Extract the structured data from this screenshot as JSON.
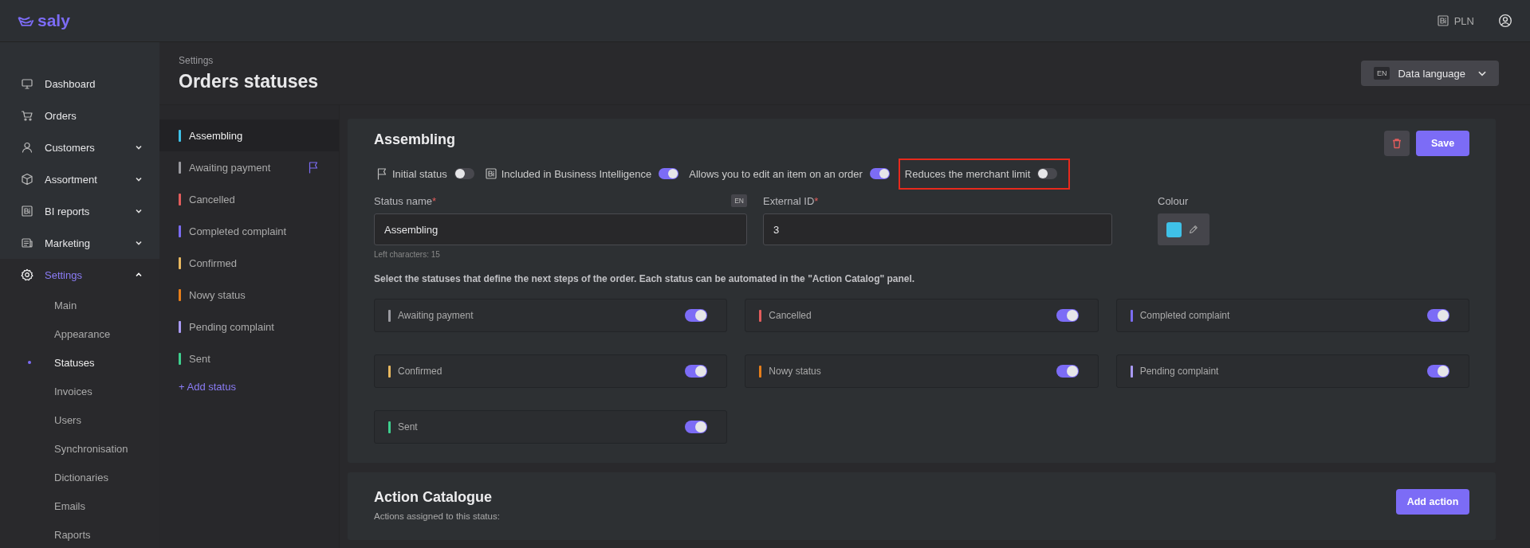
{
  "brand": {
    "name": "saly"
  },
  "topbar": {
    "currency": "PLN"
  },
  "sidebar": {
    "items": [
      {
        "label": "Dashboard",
        "selected": false
      },
      {
        "label": "Orders",
        "selected": false
      },
      {
        "label": "Customers",
        "selected": false,
        "expanded": false
      },
      {
        "label": "Assortment",
        "selected": false,
        "expanded": false
      },
      {
        "label": "BI reports",
        "selected": false,
        "expanded": false
      },
      {
        "label": "Marketing",
        "selected": false,
        "expanded": false
      },
      {
        "label": "Settings",
        "selected": true,
        "expanded": true,
        "children": [
          {
            "label": "Main",
            "selected": false
          },
          {
            "label": "Appearance",
            "selected": false
          },
          {
            "label": "Statuses",
            "selected": true
          },
          {
            "label": "Invoices",
            "selected": false
          },
          {
            "label": "Users",
            "selected": false
          },
          {
            "label": "Synchronisation",
            "selected": false
          },
          {
            "label": "Dictionaries",
            "selected": false
          },
          {
            "label": "Emails",
            "selected": false
          },
          {
            "label": "Raports",
            "selected": false
          }
        ]
      }
    ]
  },
  "header": {
    "breadcrumb": "Settings",
    "title": "Orders statuses",
    "language_code": "EN",
    "language_button": "Data language"
  },
  "statuses": [
    {
      "label": "Assembling",
      "color": "#3fc1e8",
      "selected": true,
      "initial": false
    },
    {
      "label": "Awaiting payment",
      "color": "#9a9aa0",
      "selected": false,
      "initial": true
    },
    {
      "label": "Cancelled",
      "color": "#e25c5c",
      "selected": false,
      "initial": false
    },
    {
      "label": "Completed complaint",
      "color": "#7b6cf2",
      "selected": false,
      "initial": false
    },
    {
      "label": "Confirmed",
      "color": "#e8b860",
      "selected": false,
      "initial": false
    },
    {
      "label": "Nowy status",
      "color": "#e67e1a",
      "selected": false,
      "initial": false
    },
    {
      "label": "Pending complaint",
      "color": "#a99af5",
      "selected": false,
      "initial": false
    },
    {
      "label": "Sent",
      "color": "#3ecf8e",
      "selected": false,
      "initial": false
    }
  ],
  "add_status": "+ Add status",
  "editor": {
    "title": "Assembling",
    "save": "Save",
    "options": [
      {
        "label": "Initial status",
        "on": false,
        "highlighted": false
      },
      {
        "label": "Included in Business Intelligence",
        "on": true,
        "highlighted": false
      },
      {
        "label": "Allows you to edit an item on an order",
        "on": true,
        "highlighted": false
      },
      {
        "label": "Reduces the merchant limit",
        "on": false,
        "highlighted": true
      }
    ],
    "status_name": {
      "label": "Status name",
      "required_mark": "*",
      "lang": "EN",
      "value": "Assembling",
      "hint": "Left characters: 15"
    },
    "external_id": {
      "label": "External ID",
      "required_mark": "*",
      "value": "3"
    },
    "colour": {
      "label": "Colour",
      "color": "#3fc1e8"
    },
    "next_intro": "Select the statuses that define the next steps of the order. Each status can be automated in the \"Action Catalog\" panel.",
    "next_statuses": [
      {
        "label": "Awaiting payment",
        "color": "#9a9aa0",
        "on": true
      },
      {
        "label": "Cancelled",
        "color": "#e25c5c",
        "on": true
      },
      {
        "label": "Completed complaint",
        "color": "#7b6cf2",
        "on": true
      },
      {
        "label": "Confirmed",
        "color": "#e8b860",
        "on": true
      },
      {
        "label": "Nowy status",
        "color": "#e67e1a",
        "on": true
      },
      {
        "label": "Pending complaint",
        "color": "#a99af5",
        "on": true
      },
      {
        "label": "Sent",
        "color": "#3ecf8e",
        "on": true
      }
    ]
  },
  "actions": {
    "title": "Action Catalogue",
    "subtitle": "Actions assigned to this status:",
    "add": "Add action"
  }
}
